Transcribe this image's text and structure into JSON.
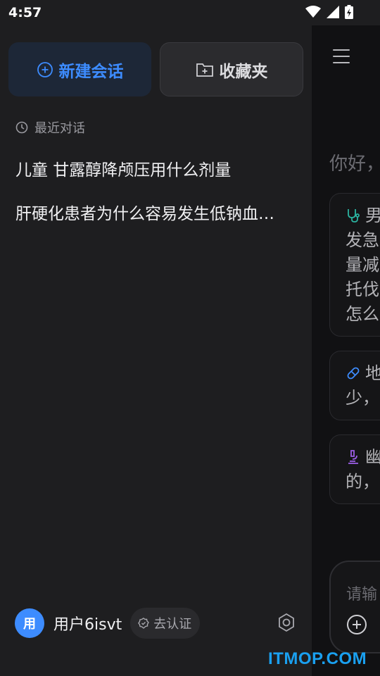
{
  "status_bar": {
    "time": "4:57"
  },
  "drawer": {
    "new_chat_label": "新建会话",
    "favorites_label": "收藏夹",
    "recent_label": "最近对话",
    "history": [
      "儿童 甘露醇降颅压用什么剂量",
      "肝硬化患者为什么容易发生低钠血…"
    ],
    "user": {
      "avatar_text": "用",
      "name": "用户6isvt",
      "verify_label": "去认证"
    }
  },
  "main": {
    "greeting": "你好，",
    "cards": [
      {
        "icon": "stethoscope-icon",
        "icon_color": "#2bb3a0",
        "lines": [
          "男",
          "发急",
          "量减",
          "托伐",
          "怎么"
        ]
      },
      {
        "icon": "pill-icon",
        "icon_color": "#3d8cff",
        "lines": [
          "地",
          "少，"
        ]
      },
      {
        "icon": "microscope-icon",
        "icon_color": "#9b5de5",
        "lines": [
          "幽",
          "的，"
        ]
      }
    ],
    "input_placeholder": "请输"
  },
  "watermark": "ITMOP.COM",
  "colors": {
    "accent": "#3d8cff",
    "drawer_bg": "#1e1e20",
    "main_bg": "#111113"
  }
}
